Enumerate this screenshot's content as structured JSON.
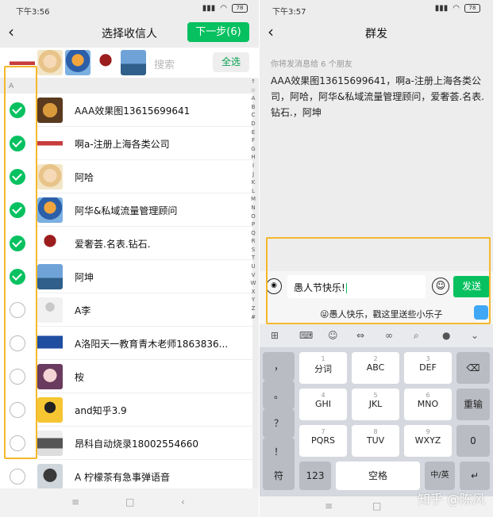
{
  "left": {
    "status": {
      "time": "下午3:56",
      "battery": "78"
    },
    "back_icon": "chevron-left-icon",
    "title": "选择收信人",
    "next_button": "下一步(6)",
    "search_placeholder": "搜索",
    "select_all": "全选",
    "section_letter": "A",
    "index_letters": [
      "↑",
      "☆",
      "A",
      "B",
      "C",
      "D",
      "E",
      "F",
      "G",
      "H",
      "I",
      "J",
      "K",
      "L",
      "M",
      "N",
      "O",
      "P",
      "Q",
      "R",
      "S",
      "T",
      "U",
      "V",
      "W",
      "X",
      "Y",
      "Z",
      "#"
    ],
    "contacts": [
      {
        "name": "AAA效果图13615699641",
        "checked": true
      },
      {
        "name": "啊a-注册上海各类公司",
        "checked": true
      },
      {
        "name": "阿哈",
        "checked": true
      },
      {
        "name": "阿华&私域流量管理顾问",
        "checked": true
      },
      {
        "name": "爱奢荟.名表.钻石.",
        "checked": true
      },
      {
        "name": "阿坤",
        "checked": true
      },
      {
        "name": "A李",
        "checked": false
      },
      {
        "name": "A洛阳天一教育青木老师1863836...",
        "checked": false
      },
      {
        "name": "桉",
        "checked": false
      },
      {
        "name": "and知乎3.9",
        "checked": false
      },
      {
        "name": "昂科自动烧录18002554660",
        "checked": false
      },
      {
        "name": "A 柠檬茶有急事弹语音",
        "checked": false
      }
    ]
  },
  "right": {
    "status": {
      "time": "下午3:57",
      "battery": "78"
    },
    "title": "群发",
    "hint": "你将发消息给 6 个朋友",
    "recipients": "AAA效果图13615699641，啊a-注册上海各类公司，阿哈，阿华&私域流量管理顾问，爱奢荟.名表.钻石.，阿坤",
    "message": "愚人节快乐!",
    "send": "发送",
    "suggestion": "😜愚人快乐，戳这里送些小乐子",
    "keyboard": {
      "side_keys": [
        "，",
        "。",
        "？",
        "！"
      ],
      "row1": [
        {
          "n": "1",
          "l": "分词"
        },
        {
          "n": "2",
          "l": "ABC"
        },
        {
          "n": "3",
          "l": "DEF"
        }
      ],
      "row2": [
        {
          "n": "4",
          "l": "GHI"
        },
        {
          "n": "5",
          "l": "JKL"
        },
        {
          "n": "6",
          "l": "MNO"
        }
      ],
      "row3": [
        {
          "n": "7",
          "l": "PQRS"
        },
        {
          "n": "8",
          "l": "TUV"
        },
        {
          "n": "9",
          "l": "WXYZ"
        }
      ],
      "delete": "⌫",
      "reset": "重输",
      "zero": "0",
      "symbol": "符",
      "num": "123",
      "space": "空格",
      "lang": "中/英",
      "enter": "↵"
    },
    "watermark": "知乎 @陈风"
  },
  "colors": {
    "accent": "#07c160",
    "highlight": "#f5b82b"
  }
}
